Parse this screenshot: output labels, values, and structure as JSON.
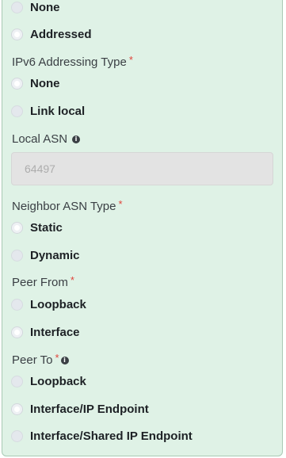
{
  "bgp_fields": {
    "top_option": "None",
    "top_option2": "Addressed",
    "ipv6_type": {
      "label": "IPv6 Addressing Type",
      "required": "*",
      "options": [
        "None",
        "Link local"
      ]
    },
    "local_asn": {
      "label": "Local ASN",
      "placeholder": "64497"
    },
    "neighbor_asn_type": {
      "label": "Neighbor ASN Type",
      "required": "*",
      "options": [
        "Static",
        "Dynamic"
      ]
    },
    "peer_from": {
      "label": "Peer From",
      "required": "*",
      "options": [
        "Loopback",
        "Interface"
      ]
    },
    "peer_to": {
      "label": "Peer To",
      "required": "*",
      "options": [
        "Loopback",
        "Interface/IP Endpoint",
        "Interface/Shared IP Endpoint"
      ]
    }
  },
  "icons": {
    "info": "info-icon",
    "required": "required-asterisk"
  },
  "colors": {
    "panel_bg": "#dff2e6",
    "required": "#e0453b"
  }
}
